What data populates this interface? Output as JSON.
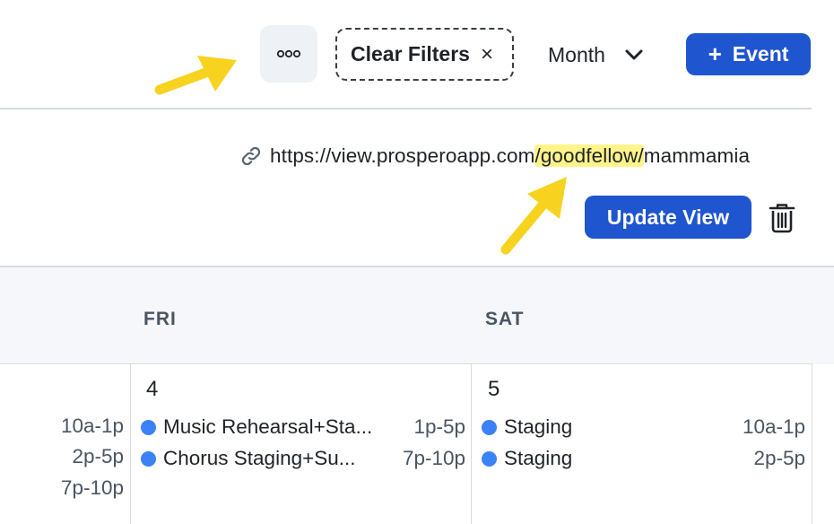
{
  "toolbar": {
    "more_icon": "ellipsis-icon",
    "clear_filters_label": "Clear Filters",
    "clear_filters_close": "×",
    "view_selector_label": "Month",
    "add_event_plus": "+",
    "add_event_label": "Event"
  },
  "share_link": {
    "icon": "link-icon",
    "url_prefix": "https://view.prosperoapp.com",
    "url_highlight": "/goodfellow/",
    "url_suffix": "mammamia",
    "highlight_color": "#fff48a"
  },
  "view_actions": {
    "update_label": "Update View",
    "delete_icon": "trash-icon"
  },
  "calendar": {
    "day_headers": [
      "FRI",
      "SAT"
    ],
    "prev_column": {
      "times": [
        "10a-1p",
        "2p-5p",
        "7p-10p"
      ]
    },
    "days": [
      {
        "date": "4",
        "events": [
          {
            "title": "Music Rehearsal+Sta...",
            "time": "1p-5p"
          },
          {
            "title": "Chorus Staging+Su...",
            "time": "7p-10p"
          }
        ]
      },
      {
        "date": "5",
        "events": [
          {
            "title": "Staging",
            "time": "10a-1p"
          },
          {
            "title": "Staging",
            "time": "2p-5p"
          }
        ]
      }
    ]
  },
  "colors": {
    "primary": "#1f55cf",
    "event_dot": "#3b82f6",
    "annotation_arrow": "#f7d320"
  }
}
